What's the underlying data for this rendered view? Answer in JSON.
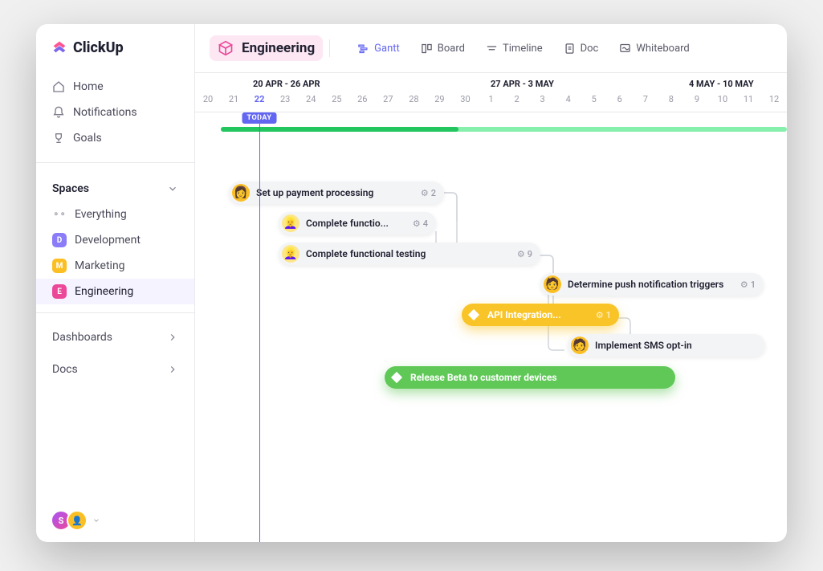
{
  "brand": "ClickUp",
  "nav": {
    "home": "Home",
    "notifications": "Notifications",
    "goals": "Goals"
  },
  "spaces": {
    "header": "Spaces",
    "everything": "Everything",
    "items": [
      {
        "letter": "D",
        "label": "Development"
      },
      {
        "letter": "M",
        "label": "Marketing"
      },
      {
        "letter": "E",
        "label": "Engineering"
      }
    ]
  },
  "dashboards": "Dashboards",
  "docs": "Docs",
  "footer": {
    "user_initial": "S"
  },
  "header": {
    "space_title": "Engineering",
    "views": {
      "gantt": "Gantt",
      "board": "Board",
      "timeline": "Timeline",
      "doc": "Doc",
      "whiteboard": "Whiteboard"
    }
  },
  "timeline": {
    "weeks": [
      "20 APR - 26 APR",
      "27 APR - 3 MAY",
      "4 MAY - 10 MAY"
    ],
    "days": [
      "20",
      "21",
      "22",
      "23",
      "24",
      "25",
      "26",
      "27",
      "28",
      "29",
      "30",
      "1",
      "2",
      "3",
      "4",
      "5",
      "6",
      "7",
      "8",
      "9",
      "10",
      "11",
      "12"
    ],
    "today_label": "TODAY",
    "today_index": 2
  },
  "tasks": {
    "t1": {
      "label": "Set up payment processing",
      "sub": "2"
    },
    "t2": {
      "label": "Complete functio...",
      "sub": "4"
    },
    "t3": {
      "label": "Complete functional testing",
      "sub": "9"
    },
    "t4": {
      "label": "Determine push notification triggers",
      "sub": "1"
    },
    "t5": {
      "label": "API Integration...",
      "sub": "1"
    },
    "t6": {
      "label": "Implement SMS opt-in"
    },
    "t7": {
      "label": "Release Beta to customer devices"
    }
  }
}
